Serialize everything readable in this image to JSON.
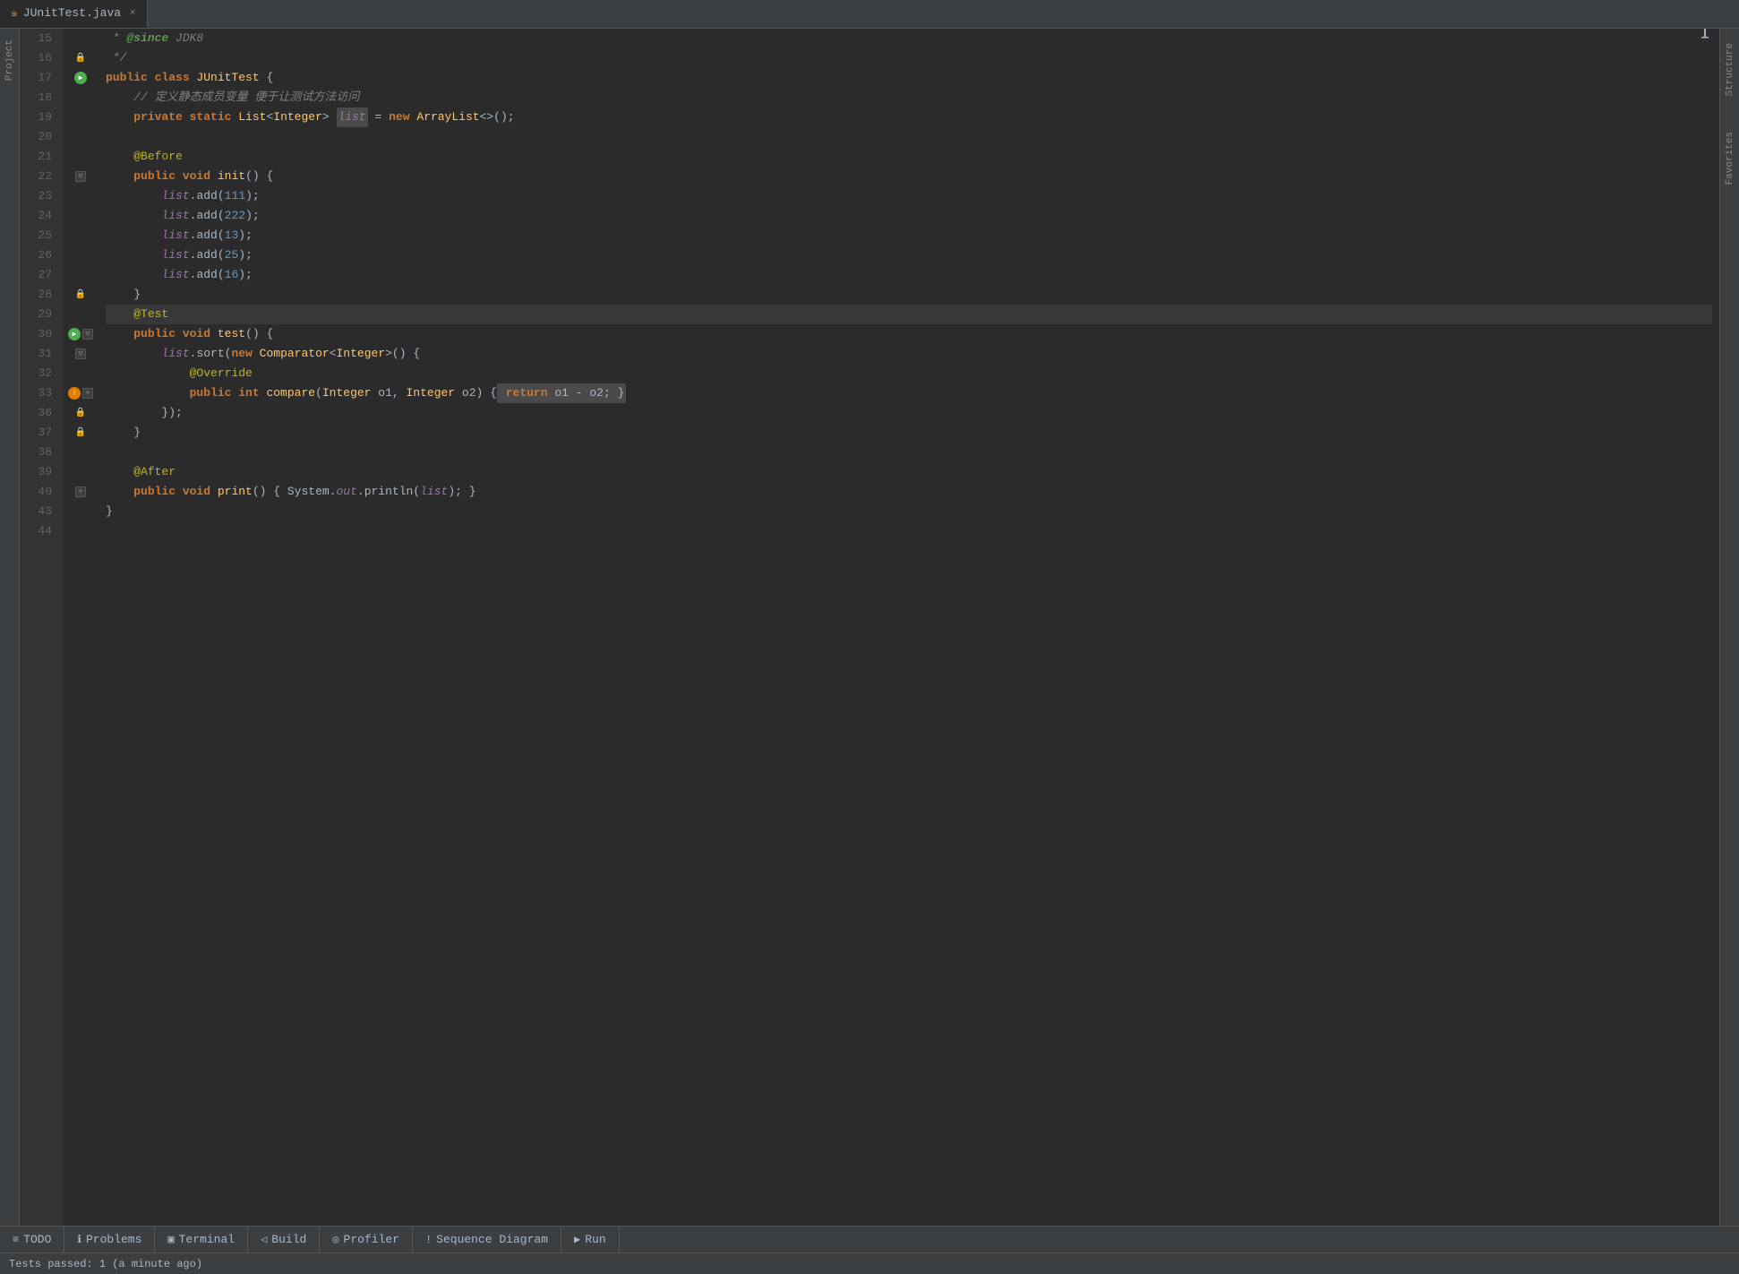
{
  "tab": {
    "icon": "☕",
    "filename": "JUnitTest.java",
    "close": "×"
  },
  "editor": {
    "lines": [
      {
        "num": 15,
        "gutter": "15",
        "margin": [],
        "code": [
          {
            "t": " * ",
            "c": "cmt"
          },
          {
            "t": "@since",
            "c": "since"
          },
          {
            "t": " JDK8",
            "c": "cmt"
          }
        ]
      },
      {
        "num": 16,
        "gutter": "16",
        "margin": [
          "lock"
        ],
        "code": [
          {
            "t": " */",
            "c": "cmt"
          }
        ]
      },
      {
        "num": 17,
        "gutter": "17",
        "margin": [
          "run"
        ],
        "code": [
          {
            "t": "public ",
            "c": "kw"
          },
          {
            "t": "class ",
            "c": "kw"
          },
          {
            "t": "JUnitTest",
            "c": "cls"
          },
          {
            "t": " {",
            "c": "plain"
          }
        ]
      },
      {
        "num": 18,
        "gutter": "18",
        "margin": [],
        "code": [
          {
            "t": "    // 定义静态成员变量 便于让测试方法访问",
            "c": "cmt"
          }
        ]
      },
      {
        "num": 19,
        "gutter": "19",
        "margin": [],
        "code": [
          {
            "t": "    ",
            "c": "plain"
          },
          {
            "t": "private static ",
            "c": "kw"
          },
          {
            "t": "List",
            "c": "cls"
          },
          {
            "t": "<",
            "c": "plain"
          },
          {
            "t": "Integer",
            "c": "cls"
          },
          {
            "t": "> ",
            "c": "plain"
          },
          {
            "t": "list",
            "c": "italic-var",
            "box": true
          },
          {
            "t": " = ",
            "c": "plain"
          },
          {
            "t": "new ",
            "c": "kw"
          },
          {
            "t": "ArrayList",
            "c": "cls"
          },
          {
            "t": "<>()",
            "c": "plain"
          },
          {
            "t": ";",
            "c": "plain"
          }
        ]
      },
      {
        "num": 20,
        "gutter": "20",
        "margin": [],
        "code": []
      },
      {
        "num": 21,
        "gutter": "21",
        "margin": [],
        "code": [
          {
            "t": "    ",
            "c": "plain"
          },
          {
            "t": "@Before",
            "c": "ann"
          }
        ]
      },
      {
        "num": 22,
        "gutter": "22",
        "margin": [
          "fold"
        ],
        "code": [
          {
            "t": "    ",
            "c": "plain"
          },
          {
            "t": "public ",
            "c": "kw"
          },
          {
            "t": "void ",
            "c": "kw"
          },
          {
            "t": "init",
            "c": "fn"
          },
          {
            "t": "() {",
            "c": "plain"
          }
        ]
      },
      {
        "num": 23,
        "gutter": "23",
        "margin": [],
        "code": [
          {
            "t": "        ",
            "c": "plain"
          },
          {
            "t": "list",
            "c": "italic-var"
          },
          {
            "t": ".add(",
            "c": "plain"
          },
          {
            "t": "111",
            "c": "num"
          },
          {
            "t": ");",
            "c": "plain"
          }
        ]
      },
      {
        "num": 24,
        "gutter": "24",
        "margin": [],
        "code": [
          {
            "t": "        ",
            "c": "plain"
          },
          {
            "t": "list",
            "c": "italic-var"
          },
          {
            "t": ".add(",
            "c": "plain"
          },
          {
            "t": "222",
            "c": "num"
          },
          {
            "t": ");",
            "c": "plain"
          }
        ]
      },
      {
        "num": 25,
        "gutter": "25",
        "margin": [],
        "code": [
          {
            "t": "        ",
            "c": "plain"
          },
          {
            "t": "list",
            "c": "italic-var"
          },
          {
            "t": ".add(",
            "c": "plain"
          },
          {
            "t": "13",
            "c": "num"
          },
          {
            "t": ");",
            "c": "plain"
          }
        ]
      },
      {
        "num": 26,
        "gutter": "26",
        "margin": [],
        "code": [
          {
            "t": "        ",
            "c": "plain"
          },
          {
            "t": "list",
            "c": "italic-var"
          },
          {
            "t": ".add(",
            "c": "plain"
          },
          {
            "t": "25",
            "c": "num"
          },
          {
            "t": ");",
            "c": "plain"
          }
        ]
      },
      {
        "num": 27,
        "gutter": "27",
        "margin": [],
        "code": [
          {
            "t": "        ",
            "c": "plain"
          },
          {
            "t": "list",
            "c": "italic-var"
          },
          {
            "t": ".add(",
            "c": "plain"
          },
          {
            "t": "16",
            "c": "num"
          },
          {
            "t": ");",
            "c": "plain"
          }
        ]
      },
      {
        "num": 28,
        "gutter": "28",
        "margin": [
          "lock"
        ],
        "code": [
          {
            "t": "    }",
            "c": "plain"
          }
        ]
      },
      {
        "num": 29,
        "gutter": "29",
        "margin": [],
        "code": [
          {
            "t": "    ",
            "c": "plain"
          },
          {
            "t": "@Test",
            "c": "ann"
          }
        ],
        "highlighted": true
      },
      {
        "num": 30,
        "gutter": "30",
        "margin": [
          "run",
          "fold"
        ],
        "code": [
          {
            "t": "    ",
            "c": "plain"
          },
          {
            "t": "public ",
            "c": "kw"
          },
          {
            "t": "void ",
            "c": "kw"
          },
          {
            "t": "test",
            "c": "fn"
          },
          {
            "t": "() {",
            "c": "plain"
          }
        ]
      },
      {
        "num": 31,
        "gutter": "31",
        "margin": [
          "fold"
        ],
        "code": [
          {
            "t": "        ",
            "c": "plain"
          },
          {
            "t": "list",
            "c": "italic-var"
          },
          {
            "t": ".sort(",
            "c": "plain"
          },
          {
            "t": "new ",
            "c": "kw"
          },
          {
            "t": "Comparator",
            "c": "cls"
          },
          {
            "t": "<",
            "c": "plain"
          },
          {
            "t": "Integer",
            "c": "cls"
          },
          {
            "t": ">() {",
            "c": "plain"
          }
        ]
      },
      {
        "num": 32,
        "gutter": "32",
        "margin": [],
        "code": [
          {
            "t": "            ",
            "c": "plain"
          },
          {
            "t": "@Override",
            "c": "ann"
          }
        ]
      },
      {
        "num": 33,
        "gutter": "33",
        "margin": [
          "warn",
          "expand"
        ],
        "code": [
          {
            "t": "            ",
            "c": "plain"
          },
          {
            "t": "public ",
            "c": "kw"
          },
          {
            "t": "int ",
            "c": "kw"
          },
          {
            "t": "compare",
            "c": "fn"
          },
          {
            "t": "(",
            "c": "plain"
          },
          {
            "t": "Integer",
            "c": "cls"
          },
          {
            "t": " o1, ",
            "c": "plain"
          },
          {
            "t": "Integer",
            "c": "cls"
          },
          {
            "t": " o2) {",
            "c": "plain"
          },
          {
            "t": " return ",
            "c": "kw",
            "brace": true
          },
          {
            "t": "o1 - o2;",
            "c": "plain",
            "brace": true
          },
          {
            "t": " }",
            "c": "plain",
            "brace": true
          }
        ]
      },
      {
        "num": 36,
        "gutter": "36",
        "margin": [
          "lock"
        ],
        "code": [
          {
            "t": "        });",
            "c": "plain"
          }
        ]
      },
      {
        "num": 37,
        "gutter": "37",
        "margin": [
          "lock"
        ],
        "code": [
          {
            "t": "    }",
            "c": "plain"
          }
        ]
      },
      {
        "num": 38,
        "gutter": "38",
        "margin": [],
        "code": []
      },
      {
        "num": 39,
        "gutter": "39",
        "margin": [],
        "code": [
          {
            "t": "    ",
            "c": "plain"
          },
          {
            "t": "@After",
            "c": "ann"
          }
        ]
      },
      {
        "num": 40,
        "gutter": "40",
        "margin": [
          "expand"
        ],
        "code": [
          {
            "t": "    ",
            "c": "plain"
          },
          {
            "t": "public ",
            "c": "kw"
          },
          {
            "t": "void ",
            "c": "kw"
          },
          {
            "t": "print",
            "c": "fn"
          },
          {
            "t": "() { ",
            "c": "plain"
          },
          {
            "t": "System.",
            "c": "plain"
          },
          {
            "t": "out",
            "c": "italic-var"
          },
          {
            "t": ".println(",
            "c": "plain"
          },
          {
            "t": "list",
            "c": "italic-var"
          },
          {
            "t": "); }",
            "c": "plain"
          }
        ]
      },
      {
        "num": 43,
        "gutter": "43",
        "margin": [],
        "code": [
          {
            "t": "}",
            "c": "plain"
          }
        ]
      },
      {
        "num": 44,
        "gutter": "44",
        "margin": [],
        "code": []
      }
    ]
  },
  "toolbar": {
    "items": [
      {
        "icon": "≡",
        "label": "TODO"
      },
      {
        "icon": "ℹ",
        "label": "Problems"
      },
      {
        "icon": "▣",
        "label": "Terminal"
      },
      {
        "icon": "◁",
        "label": "Build"
      },
      {
        "icon": "◎",
        "label": "Profiler"
      },
      {
        "icon": "!",
        "label": "Sequence Diagram"
      },
      {
        "icon": "▶",
        "label": "Run"
      }
    ]
  },
  "statusbar": {
    "text": "Tests passed: 1 (a minute ago)"
  },
  "sidebar": {
    "items": [
      "Project",
      "Structure",
      "Favorites"
    ]
  },
  "cursor": {
    "symbol": "I"
  }
}
